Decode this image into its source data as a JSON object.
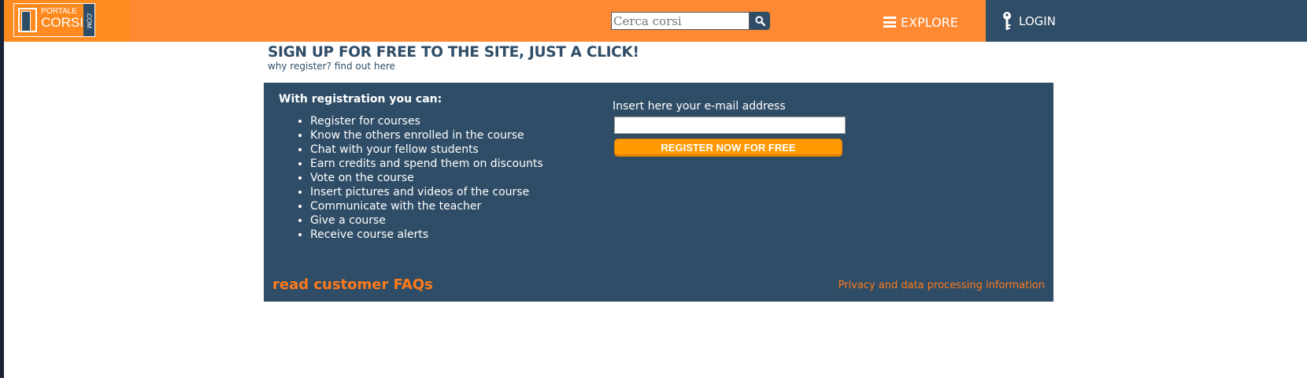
{
  "header": {
    "logo": {
      "line1": "PORTALE",
      "line2": "CORSI",
      "suffix": ".COM"
    },
    "search": {
      "placeholder": "Cerca corsi",
      "icon": "search-icon"
    },
    "explore_label": "EXPLORE",
    "login_label": "LOGIN"
  },
  "main": {
    "headline": "SIGN UP FOR FREE TO THE SITE, JUST A CLICK!",
    "subline": "why register? find out here"
  },
  "panel": {
    "benefits_title": "With registration you can:",
    "benefits": [
      "Register for courses",
      "Know the others enrolled in the course",
      "Chat with your fellow students",
      "Earn credits and spend them on discounts",
      "Vote on the course",
      "Insert pictures and videos of the course",
      "Communicate with the teacher",
      "Give a course",
      "Receive course alerts"
    ],
    "email_label": "Insert here your e-mail address",
    "email_value": "",
    "register_label": "REGISTER NOW FOR FREE",
    "faq_link": "read customer FAQs",
    "privacy_link": "Privacy and data processing information"
  },
  "colors": {
    "header_orange": "#ff8a33",
    "navy": "#2f4d66",
    "button_orange": "#ff9900",
    "link_orange": "#ff7a1a"
  }
}
